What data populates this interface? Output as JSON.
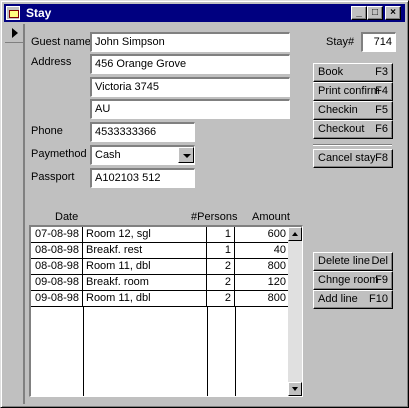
{
  "window": {
    "title": "Stay",
    "controls": {
      "minimize": "_",
      "maximize": "□",
      "close": "×"
    }
  },
  "form": {
    "guest_name_label": "Guest name",
    "guest_name": "John Simpson",
    "address_label": "Address",
    "address_line1": "456 Orange Grove",
    "address_line2": "Victoria 3745",
    "address_line3": "AU",
    "phone_label": "Phone",
    "phone": "4533333366",
    "paymethod_label": "Paymethod",
    "paymethod": "Cash",
    "passport_label": "Passport",
    "passport": "A102103 512",
    "stay_label": "Stay#",
    "stay_number": "714"
  },
  "buttons": {
    "book": {
      "label": "Book",
      "key": "F3"
    },
    "print_confirm": {
      "label": "Print confirm",
      "key": "F4"
    },
    "checkin": {
      "label": "Checkin",
      "key": "F5"
    },
    "checkout": {
      "label": "Checkout",
      "key": "F6"
    },
    "cancel_stay": {
      "label": "Cancel stay",
      "key": "F8"
    },
    "delete_line": {
      "label": "Delete line",
      "key": "Del"
    },
    "change_room": {
      "label": "Chnge room",
      "key": "F9"
    },
    "add_line": {
      "label": "Add line",
      "key": "F10"
    }
  },
  "grid": {
    "headers": {
      "date": "Date",
      "persons": "#Persons",
      "amount": "Amount"
    },
    "rows": [
      {
        "date": "07-08-98",
        "text": "Room 12, sgl",
        "persons": "1",
        "amount": "600"
      },
      {
        "date": "08-08-98",
        "text": "Breakf. rest",
        "persons": "1",
        "amount": "40"
      },
      {
        "date": "08-08-98",
        "text": "Room 11, dbl",
        "persons": "2",
        "amount": "800"
      },
      {
        "date": "09-08-98",
        "text": "Breakf. room",
        "persons": "2",
        "amount": "120"
      },
      {
        "date": "09-08-98",
        "text": "Room 11, dbl",
        "persons": "2",
        "amount": "800"
      }
    ]
  }
}
